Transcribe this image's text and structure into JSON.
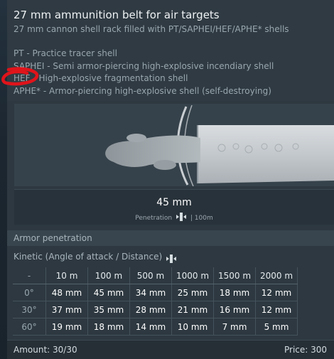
{
  "header": {
    "title": "27 mm ammunition belt for air targets",
    "subtitle": "27 mm cannon shell rack filled with PT/SAPHEI/HEF/APHE* shells",
    "legend": [
      "PT - Practice tracer shell",
      "SAPHEI - Semi armor-piercing high-explosive incendiary shell",
      "HEF - High-explosive fragmentation shell",
      "APHE* - Armor-piercing high-explosive shell (self-destroying)"
    ]
  },
  "penetration": {
    "value": "45 mm",
    "caption_left": "Penetration",
    "caption_right": "| 100m"
  },
  "armor_section": {
    "label": "Armor penetration",
    "kinetic_label": "Kinetic (Angle of attack / Distance)"
  },
  "table": {
    "corner": "-",
    "distances": [
      "10 m",
      "100 m",
      "500 m",
      "1000 m",
      "1500 m",
      "2000 m"
    ],
    "rows": [
      {
        "angle": "0°",
        "values": [
          "48 mm",
          "45 mm",
          "34 mm",
          "25 mm",
          "18 mm",
          "12 mm"
        ]
      },
      {
        "angle": "30°",
        "values": [
          "37 mm",
          "35 mm",
          "28 mm",
          "21 mm",
          "16 mm",
          "12 mm"
        ]
      },
      {
        "angle": "60°",
        "values": [
          "19 mm",
          "18 mm",
          "14 mm",
          "10 mm",
          "7 mm",
          "5 mm"
        ]
      }
    ]
  },
  "footer": {
    "amount": "Amount: 30/30",
    "price": "Price: 300"
  },
  "colors": {
    "annotation": "#e0141b",
    "panel": "#2d3840"
  },
  "icons": {
    "penetration": "penetration-arrows-icon",
    "kinetic": "penetration-arrows-icon"
  }
}
